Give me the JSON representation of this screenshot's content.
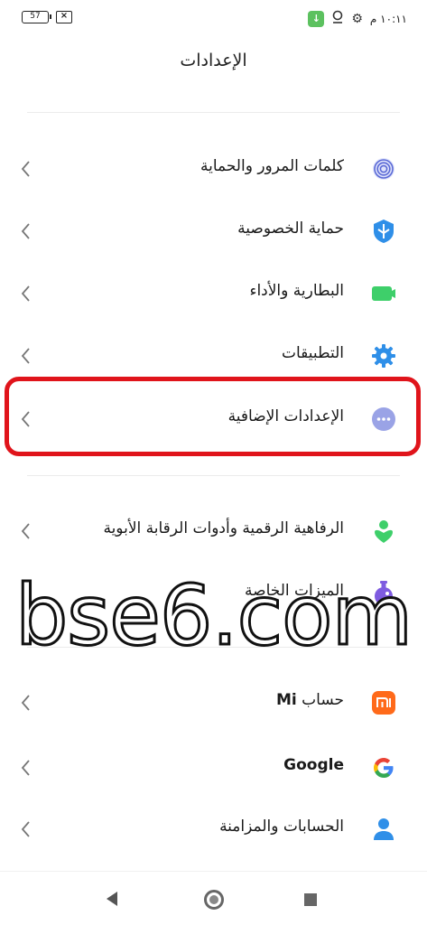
{
  "status_bar": {
    "battery": "57",
    "time": "١٠:١١ م",
    "icons": [
      "battery-icon",
      "no-signal-icon",
      "download-notification-icon",
      "location-pin-icon",
      "gear-icon"
    ]
  },
  "page_title": "الإعدادات",
  "items": [
    {
      "label": "كلمات المرور والحماية",
      "icon": "fingerprint-icon",
      "color": "#5b6ad6"
    },
    {
      "label": "حماية الخصوصية",
      "icon": "shield-icon",
      "color": "#2f8fe8"
    },
    {
      "label": "البطارية والأداء",
      "icon": "battery-performance-icon",
      "color": "#3ecf6a"
    },
    {
      "label": "التطبيقات",
      "icon": "gear-icon",
      "color": "#2f8fe8"
    },
    {
      "label": "الإعدادات الإضافية",
      "icon": "more-dots-icon",
      "color": "#9aa3e6"
    },
    {
      "label": "الرفاهية الرقمية وأدوات الرقابة الأبوية",
      "icon": "wellbeing-icon",
      "color": "#3ecf6a"
    },
    {
      "label": "الميزات الخاصة",
      "icon": "potion-icon",
      "color": "#7e5be0"
    },
    {
      "label_prefix": "حساب",
      "label_bold": "Mi",
      "icon": "mi-logo-icon",
      "color": "#ff6a1a"
    },
    {
      "label": "Google",
      "icon": "google-logo-icon",
      "color": "#4285F4"
    },
    {
      "label": "الحسابات والمزامنة",
      "icon": "user-account-icon",
      "color": "#2f8fe8"
    }
  ],
  "watermark": "bse6.com",
  "highlight_color": "#e0141b"
}
